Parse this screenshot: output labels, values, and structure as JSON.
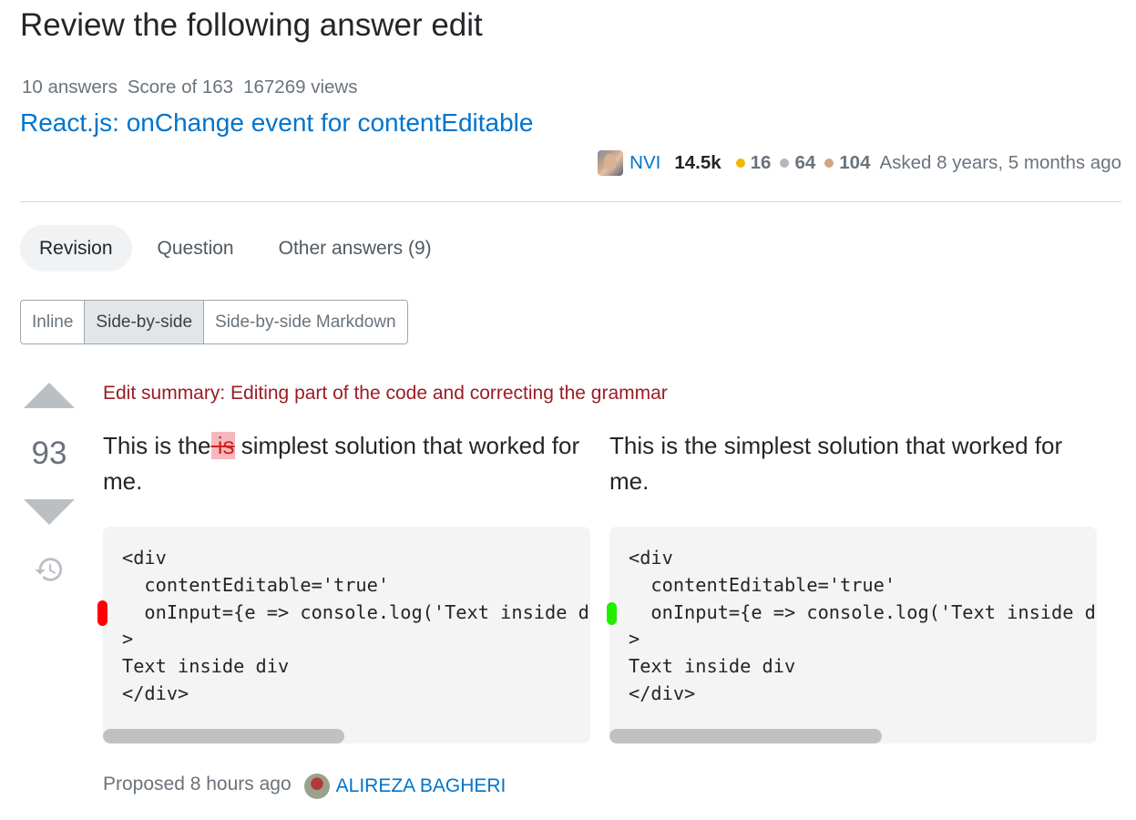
{
  "page": {
    "title": "Review the following answer edit"
  },
  "question": {
    "stats": [
      "10 answers",
      "Score of 163",
      "167269 views"
    ],
    "title": "React.js: onChange event for contentEditable",
    "owner": {
      "name": "NVI",
      "reputation": "14.5k",
      "badges": [
        {
          "type": "gold",
          "count": "16",
          "color": "#f1b600"
        },
        {
          "type": "silver",
          "count": "64",
          "color": "#b4b8bc"
        },
        {
          "type": "bronze",
          "count": "104",
          "color": "#d1a684"
        }
      ],
      "asked": "Asked 8 years, 5 months ago"
    }
  },
  "tabs": [
    {
      "label": "Revision",
      "active": true
    },
    {
      "label": "Question",
      "active": false
    },
    {
      "label": "Other answers (9)",
      "active": false
    }
  ],
  "view_modes": [
    {
      "label": "Inline",
      "active": false
    },
    {
      "label": "Side-by-side",
      "active": true
    },
    {
      "label": "Side-by-side Markdown",
      "active": false
    }
  ],
  "answer": {
    "score": "93",
    "edit_summary": "Edit summary: Editing part of the code and correcting the grammar",
    "left": {
      "para_before": "This is the",
      "deleted": " is",
      "para_after": " simplest solution that worked for me.",
      "code": "<div\n  contentEditable='true'\n  onInput={e => console.log('Text inside div', e.currentTarget.textContent)}\n>\nText inside div\n</div>"
    },
    "right": {
      "para": "This is the simplest solution that worked for me.",
      "code": "<div\n  contentEditable='true'\n  onInput={e => console.log('Text inside div', e.currentTarget.textContent)}\n>\nText inside div\n</div>"
    },
    "proposed": "Proposed 8 hours ago",
    "editor": "ALIREZA BAGHERI"
  },
  "colors": {
    "link": "#0074cc",
    "deleted_bg": "#f6b8bc",
    "summary": "#9b1c24"
  }
}
